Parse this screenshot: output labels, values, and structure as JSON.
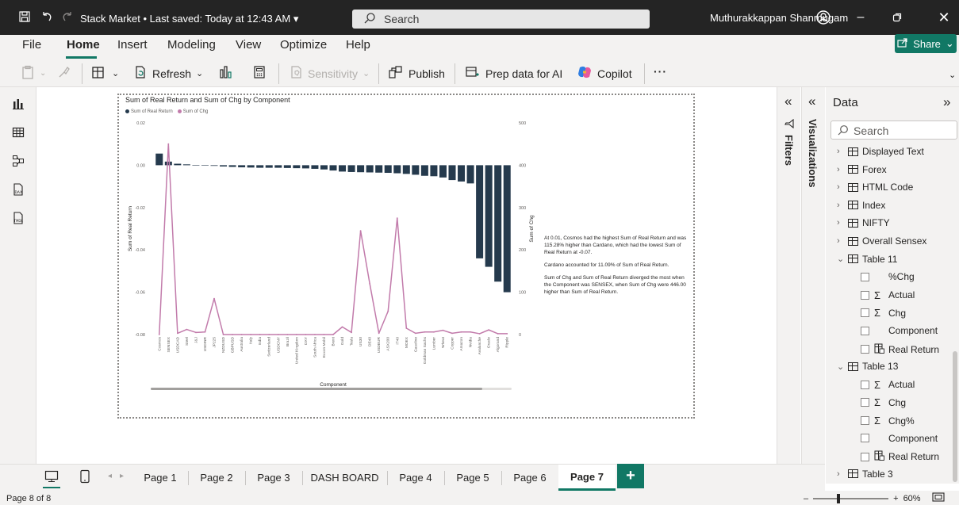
{
  "titlebar": {
    "title": "Stack Market • Last saved: Today at 12:43 AM",
    "search_placeholder": "Search",
    "user": "Muthurakkappan Shanmugam"
  },
  "menu": {
    "items": [
      "File",
      "Home",
      "Insert",
      "Modeling",
      "View",
      "Optimize",
      "Help"
    ],
    "active": "Home",
    "share_label": "Share"
  },
  "ribbon": {
    "refresh": "Refresh",
    "sensitivity": "Sensitivity",
    "publish": "Publish",
    "prep_data": "Prep data for AI",
    "copilot": "Copilot",
    "more": "···"
  },
  "panes": {
    "filters": "Filters",
    "visualizations": "Visualizations"
  },
  "data_pane": {
    "title": "Data",
    "search_placeholder": "Search",
    "tree": [
      {
        "type": "table",
        "label": "Displayed Text",
        "expanded": false
      },
      {
        "type": "table",
        "label": "Forex",
        "expanded": false
      },
      {
        "type": "table",
        "label": "HTML Code",
        "expanded": false
      },
      {
        "type": "table",
        "label": "Index",
        "expanded": false
      },
      {
        "type": "table",
        "label": "NIFTY",
        "expanded": false
      },
      {
        "type": "table",
        "label": "Overall Sensex",
        "expanded": false
      },
      {
        "type": "table",
        "label": "Table 11",
        "expanded": true
      },
      {
        "type": "field",
        "label": "%Chg",
        "icon": "none"
      },
      {
        "type": "field",
        "label": "Actual",
        "icon": "sigma"
      },
      {
        "type": "field",
        "label": "Chg",
        "icon": "sigma"
      },
      {
        "type": "field",
        "label": "Component",
        "icon": "none"
      },
      {
        "type": "field",
        "label": "Real Return",
        "icon": "calc"
      },
      {
        "type": "table",
        "label": "Table 13",
        "expanded": true
      },
      {
        "type": "field",
        "label": "Actual",
        "icon": "sigma"
      },
      {
        "type": "field",
        "label": "Chg",
        "icon": "sigma"
      },
      {
        "type": "field",
        "label": "Chg%",
        "icon": "sigma"
      },
      {
        "type": "field",
        "label": "Component",
        "icon": "none"
      },
      {
        "type": "field",
        "label": "Real Return",
        "icon": "calc"
      },
      {
        "type": "table",
        "label": "Table 3",
        "expanded": false
      }
    ]
  },
  "pages": {
    "tabs": [
      "Page 1",
      "Page 2",
      "Page 3",
      "DASH BOARD",
      "Page 4",
      "Page 5",
      "Page 6",
      "Page 7"
    ],
    "active": "Page 7",
    "add_label": "+"
  },
  "status": {
    "page_info": "Page 8 of 8",
    "zoom": "60%"
  },
  "narrative": {
    "p1": "At 0.01, Cosmos had the highest Sum of Real Return and was 115.28% higher than Cardano, which had the lowest Sum of Real Return at -0.07.",
    "p2": "Cardano accounted for 11.09% of Sum of Real Return.",
    "p3": "Sum of Chg and Sum of Real Return diverged the most when the Component was SENSEX, when Sum of Chg were 446.00 higher than Sum of Real Return."
  },
  "chart_data": {
    "type": "bar",
    "title": "Sum of Real Return and Sum of Chg by Component",
    "xlabel": "Component",
    "ylabel": "Sum of Real Return",
    "y2label": "Sum of Chg",
    "ylim": [
      -0.08,
      0.02
    ],
    "y2lim": [
      0,
      500
    ],
    "yticks": [
      "0.02",
      "0.00",
      "-0.02",
      "-0.04",
      "-0.06",
      "-0.08"
    ],
    "y2ticks": [
      "500",
      "400",
      "300",
      "200",
      "100",
      "0"
    ],
    "legend_position": "top-left",
    "categories": [
      "Cosmos",
      "SENSEX",
      "USDCAD",
      "Steel",
      "J&J",
      "USDINR",
      "JP225",
      "NZDUSD",
      "GBPUSD",
      "Australia",
      "Italy",
      "India",
      "Switzerland",
      "USDCNY",
      "Brazil",
      "United Kingdom",
      "DXY",
      "South Africa",
      "Exxon Mobil",
      "Brent",
      "Gold",
      "Tesla",
      "US30",
      "DE40",
      "USDEUR",
      "ASX200",
      "IT40",
      "MOEX",
      "Gasoline",
      "Goldman Sachs",
      "Lumber",
      "Wheat",
      "Copper",
      "Amazon",
      "Nvidia",
      "Avalanche",
      "Oracle",
      "Algorand",
      "Ripple"
    ],
    "series": [
      {
        "name": "Sum of Real Return",
        "kind": "bar",
        "color": "#253a4d",
        "values": [
          0.0055,
          0.0017,
          0.0007,
          0.0004,
          0.0,
          -0.0001,
          -0.0003,
          -0.0006,
          -0.0008,
          -0.001,
          -0.0011,
          -0.0012,
          -0.0012,
          -0.0012,
          -0.0013,
          -0.0014,
          -0.0015,
          -0.0017,
          -0.002,
          -0.0025,
          -0.003,
          -0.0032,
          -0.0033,
          -0.0034,
          -0.0035,
          -0.0036,
          -0.0038,
          -0.0041,
          -0.0045,
          -0.005,
          -0.0052,
          -0.0058,
          -0.007,
          -0.0077,
          -0.0086,
          -0.044,
          -0.048,
          -0.055,
          -0.06
        ]
      },
      {
        "name": "Sum of Chg",
        "kind": "line",
        "color": "#c27bab",
        "values": [
          0,
          450,
          3,
          12,
          5,
          6,
          85,
          0,
          0,
          0,
          0,
          0,
          0,
          0,
          0,
          0,
          0,
          0,
          0,
          0,
          18,
          5,
          245,
          120,
          3,
          55,
          275,
          15,
          3,
          6,
          6,
          10,
          3,
          6,
          6,
          2,
          11,
          2,
          2
        ]
      }
    ]
  }
}
